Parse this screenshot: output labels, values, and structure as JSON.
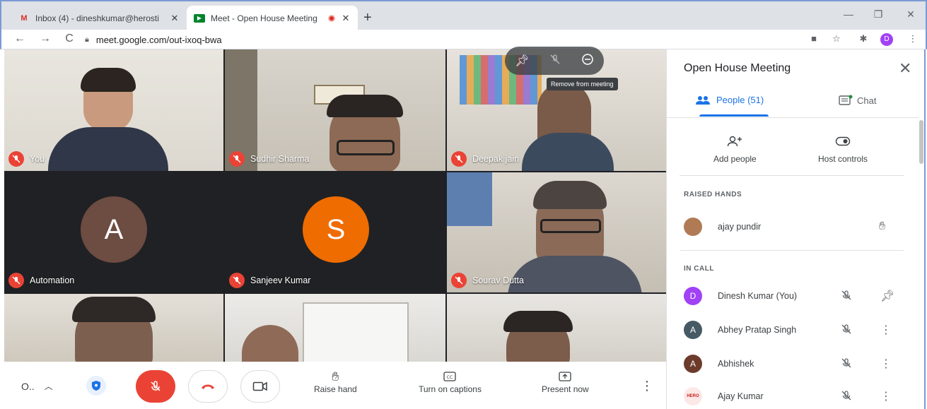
{
  "browser": {
    "tabs": [
      {
        "title": "Inbox (4) - dineshkumar@herosti",
        "active": false
      },
      {
        "title": "Meet - Open House Meeting",
        "active": true
      }
    ],
    "url": "meet.google.com/out-ixoq-bwa",
    "profile_initial": "D"
  },
  "meeting": {
    "tiles": [
      {
        "name": "You",
        "type": "video"
      },
      {
        "name": "Sudhir Sharma",
        "type": "video"
      },
      {
        "name": "Deepak jain",
        "type": "video"
      },
      {
        "name": "Automation",
        "type": "avatar",
        "initial": "A",
        "color": "#6d4c41"
      },
      {
        "name": "Sanjeev Kumar",
        "type": "avatar",
        "initial": "S",
        "color": "#ef6c00"
      },
      {
        "name": "Sourav Dutta",
        "type": "video"
      }
    ],
    "tooltip": "Remove from meeting"
  },
  "controls": {
    "meeting_code_short": "O..",
    "raise_hand": "Raise hand",
    "captions": "Turn on captions",
    "present": "Present now"
  },
  "panel": {
    "title": "Open House Meeting",
    "tab_people": "People (51)",
    "tab_chat": "Chat",
    "add_people": "Add people",
    "host_controls": "Host controls",
    "raised_hands_label": "RAISED HANDS",
    "raised_hands": [
      {
        "name": "ajay pundir"
      }
    ],
    "in_call_label": "IN CALL",
    "in_call": [
      {
        "name": "Dinesh Kumar (You)",
        "initial": "D",
        "color": "#a142f4"
      },
      {
        "name": "Abhey Pratap Singh",
        "initial": "A",
        "color": "#455a64"
      },
      {
        "name": "Abhishek",
        "initial": "A",
        "color": "#6d3b2c"
      },
      {
        "name": "Ajay Kumar",
        "initial": "HERO",
        "color": "#fce8e6"
      }
    ]
  },
  "colors": {
    "accent": "#1a73e8",
    "mic_off": "#ea4335",
    "end_call": "#ea4335"
  }
}
